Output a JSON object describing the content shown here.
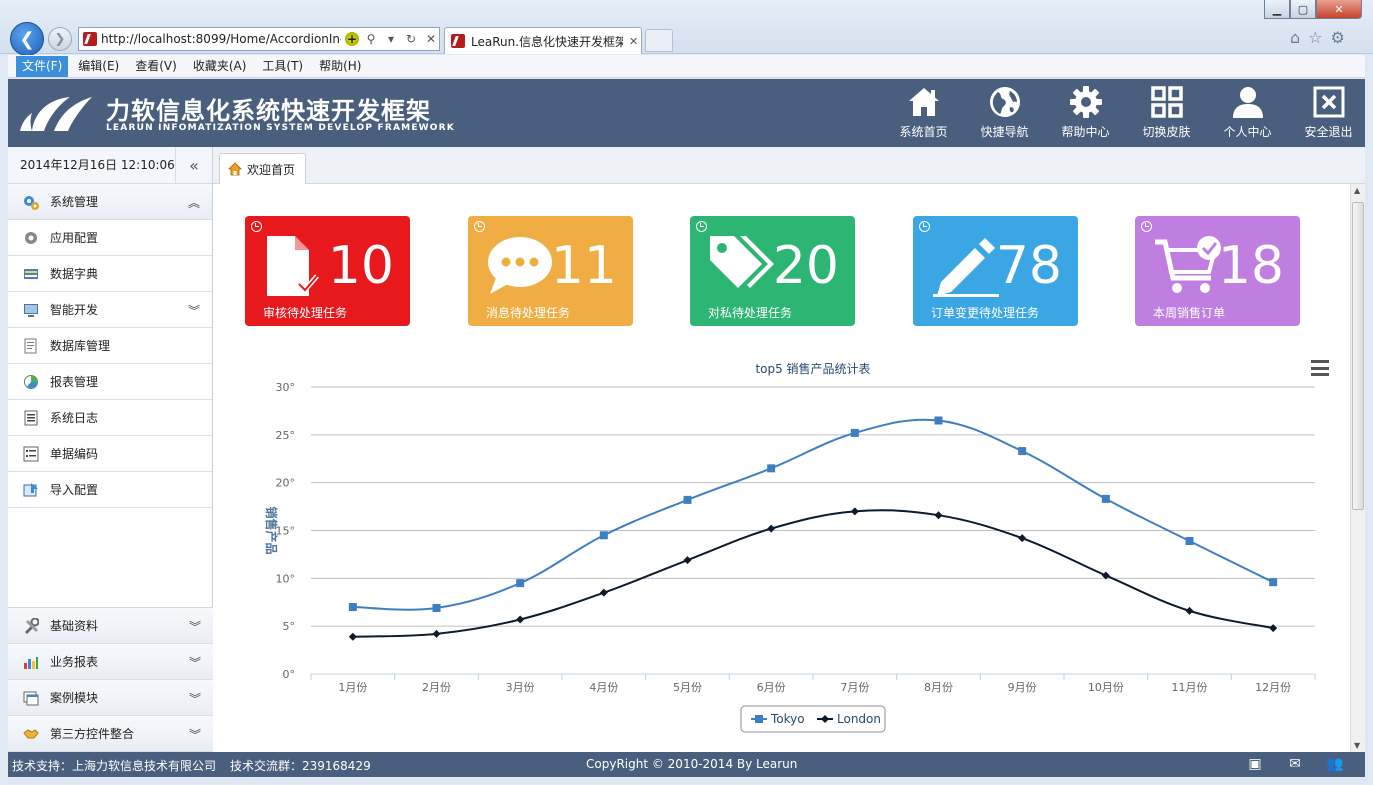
{
  "browser": {
    "address": "http://localhost:8099/Home/AccordionInd",
    "tab_title": "LeaRun.信息化快速开发框架",
    "menu": [
      "文件(F)",
      "编辑(E)",
      "查看(V)",
      "收藏夹(A)",
      "工具(T)",
      "帮助(H)"
    ]
  },
  "header": {
    "title": "力软信息化系统快速开发框架",
    "subtitle": "LEARUN INFOMATIZATION SYSTEM DEVELOP FRAMEWORK",
    "nav": [
      {
        "label": "系统首页",
        "icon": "home-icon"
      },
      {
        "label": "快捷导航",
        "icon": "globe-icon"
      },
      {
        "label": "帮助中心",
        "icon": "gear-icon"
      },
      {
        "label": "切换皮肤",
        "icon": "grid-icon"
      },
      {
        "label": "个人中心",
        "icon": "user-icon"
      },
      {
        "label": "安全退出",
        "icon": "logout-icon"
      }
    ]
  },
  "sidebar": {
    "clock": "2014年12月16日 12:10:06",
    "groups_top": [
      {
        "label": "系统管理",
        "expanded": true
      }
    ],
    "items": [
      {
        "label": "应用配置",
        "icon": "gear-small-icon"
      },
      {
        "label": "数据字典",
        "icon": "book-icon"
      },
      {
        "label": "智能开发",
        "icon": "monitor-icon",
        "has_submenu": true
      },
      {
        "label": "数据库管理",
        "icon": "database-icon"
      },
      {
        "label": "报表管理",
        "icon": "report-icon"
      },
      {
        "label": "系统日志",
        "icon": "log-icon"
      },
      {
        "label": "单据编码",
        "icon": "list-icon"
      },
      {
        "label": "导入配置",
        "icon": "import-icon"
      }
    ],
    "groups_bottom": [
      {
        "label": "基础资料",
        "icon": "tools-icon"
      },
      {
        "label": "业务报表",
        "icon": "chart-bar-icon"
      },
      {
        "label": "案例模块",
        "icon": "window-icon"
      },
      {
        "label": "第三方控件整合",
        "icon": "handshake-icon"
      }
    ]
  },
  "main": {
    "tab": "欢迎首页",
    "cards": [
      {
        "label": "审核待处理任务",
        "count": "10",
        "color": "#e8191c",
        "icon": "document-check-icon"
      },
      {
        "label": "消息待处理任务",
        "count": "11",
        "color": "#f0ad44",
        "icon": "chat-icon"
      },
      {
        "label": "对私待处理任务",
        "count": "20",
        "color": "#2db574",
        "icon": "tags-icon"
      },
      {
        "label": "订单变更待处理任务",
        "count": "78",
        "color": "#3aa7e4",
        "icon": "pencil-icon"
      },
      {
        "label": "本周销售订单",
        "count": "18",
        "color": "#c07fe0",
        "icon": "cart-icon"
      }
    ]
  },
  "chart_data": {
    "type": "line",
    "title": "top5 销售产品统计表",
    "ylabel": "销售产品",
    "ylim": [
      0,
      30
    ],
    "yticks": [
      "0°",
      "5°",
      "10°",
      "15°",
      "20°",
      "25°",
      "30°"
    ],
    "categories": [
      "1月份",
      "2月份",
      "3月份",
      "4月份",
      "5月份",
      "6月份",
      "7月份",
      "8月份",
      "9月份",
      "10月份",
      "11月份",
      "12月份"
    ],
    "series": [
      {
        "name": "Tokyo",
        "color": "#3d7fc1",
        "marker": "square",
        "values": [
          7.0,
          6.9,
          9.5,
          14.5,
          18.2,
          21.5,
          25.2,
          26.5,
          23.3,
          18.3,
          13.9,
          9.6
        ]
      },
      {
        "name": "London",
        "color": "#0d1b2e",
        "marker": "diamond",
        "values": [
          3.9,
          4.2,
          5.7,
          8.5,
          11.9,
          15.2,
          17.0,
          16.6,
          14.2,
          10.3,
          6.6,
          4.8
        ]
      }
    ],
    "grid": true,
    "legend": "bottom-center"
  },
  "footer": {
    "support": "技术支持：上海力软信息技术有限公司",
    "qq": "技术交流群：239168429",
    "copyright": "CopyRight © 2010-2014 By Learun"
  }
}
